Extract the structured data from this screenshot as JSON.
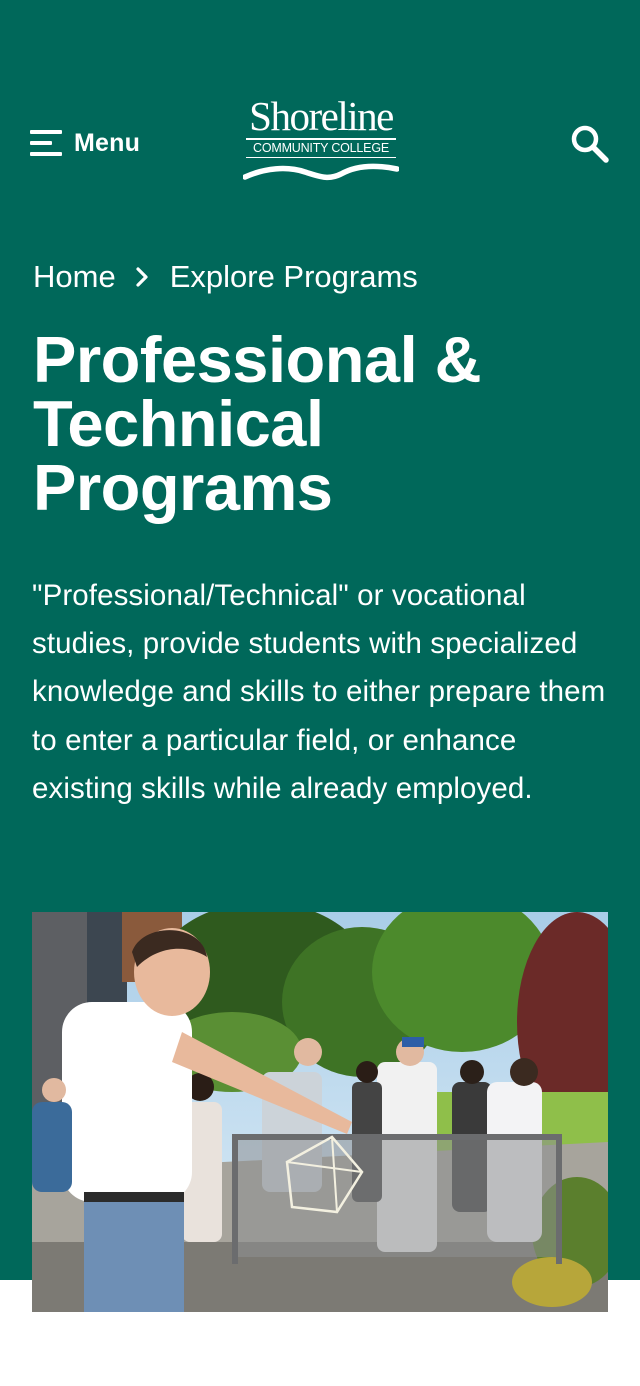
{
  "header": {
    "menu_label": "Menu",
    "logo": {
      "wordmark": "Shoreline",
      "subline": "COMMUNITY COLLEGE"
    },
    "icons": {
      "menu": "hamburger-icon",
      "search": "search-icon",
      "separator": "chevron-right-icon"
    }
  },
  "breadcrumb": [
    {
      "label": "Home"
    },
    {
      "label": "Explore Programs"
    }
  ],
  "page": {
    "title": "Professional & Technical Programs",
    "intro": "\"Professional/Technical\" or vocational studies, provide students with specialized knowledge and skills to either prepare them to enter a particular field, or enhance existing skills while already employed."
  },
  "colors": {
    "brand_green": "#00685a",
    "text": "#ffffff",
    "page_background": "#ffffff"
  }
}
